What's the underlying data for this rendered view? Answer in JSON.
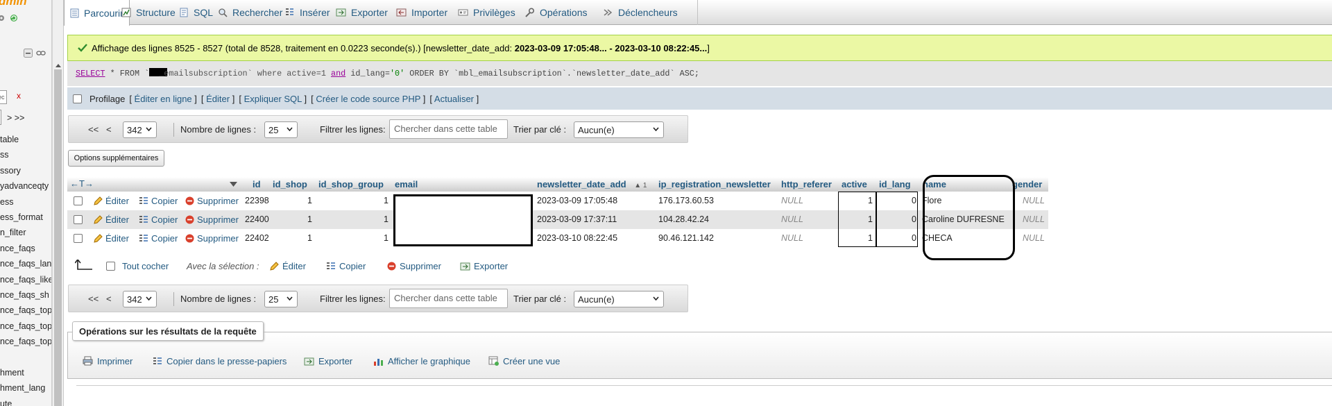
{
  "sidebar": {
    "logo_fragment": "dmin",
    "tables": [
      "table",
      "ss",
      "ssory",
      "yadvanceqty",
      "ess",
      "ess_format",
      "n_filter",
      "nce_faqs",
      "nce_faqs_lan",
      "nce_faqs_like",
      "nce_faqs_sh",
      "nce_faqs_top",
      "nce_faqs_top",
      "nce_faqs_top",
      "",
      "hment",
      "hment_lang",
      "ute"
    ],
    "filter_value": "ec",
    "filter_clear": "x",
    "pager": "> >>"
  },
  "tabs": [
    {
      "label": "Parcourir",
      "icon": "browse-icon",
      "active": true
    },
    {
      "label": "Structure",
      "icon": "structure-icon"
    },
    {
      "label": "SQL",
      "icon": "sql-icon"
    },
    {
      "label": "Rechercher",
      "icon": "search-icon"
    },
    {
      "label": "Insérer",
      "icon": "insert-icon"
    },
    {
      "label": "Exporter",
      "icon": "export-icon"
    },
    {
      "label": "Importer",
      "icon": "import-icon"
    },
    {
      "label": "Privilèges",
      "icon": "privileges-icon"
    },
    {
      "label": "Opérations",
      "icon": "operations-icon"
    },
    {
      "label": "Déclencheurs",
      "icon": "triggers-icon"
    }
  ],
  "message": {
    "text": "Affichage des lignes 8525 - 8527 (total de 8528, traitement en 0.0223 seconde(s).) [newsletter_date_add: ",
    "bold": "2023-03-09 17:05:48... - 2023-03-10 08:22:45...",
    "suffix": "]"
  },
  "query": {
    "select": "SELECT",
    "from_part": " * FROM `",
    "table": "_emailsubscription` where active=1 ",
    "and": "and",
    "cond": " id_lang=",
    "str": "'0'",
    "order": " ORDER BY `mbl_emailsubscription`.`newsletter_date_add` ASC;"
  },
  "profiling": {
    "label": "Profilage",
    "links": [
      "Éditer en ligne",
      "Éditer",
      "Expliquer SQL",
      "Créer le code source PHP",
      "Actualiser"
    ]
  },
  "nav": {
    "first": "<<",
    "prev": "<",
    "page": "342",
    "rows_label": "Nombre de lignes :",
    "rows_value": "25",
    "filter_label": "Filtrer les lignes:",
    "filter_placeholder": "Chercher dans cette table",
    "sort_label": "Trier par clé :",
    "sort_value": "Aucun(e)"
  },
  "options_button": "Options supplémentaires",
  "table": {
    "columns": [
      "id",
      "id_shop",
      "id_shop_group",
      "email",
      "newsletter_date_add",
      "ip_registration_newsletter",
      "http_referer",
      "active",
      "id_lang",
      "name",
      "gender"
    ],
    "sort_indicator": "▲ 1",
    "actions": {
      "edit": "Éditer",
      "copy": "Copier",
      "delete": "Supprimer"
    },
    "rows": [
      {
        "id": "22398",
        "id_shop": "1",
        "id_shop_group": "1",
        "email": "",
        "date": "2023-03-09 17:05:48",
        "ip": "176.173.60.53",
        "referer": "NULL",
        "active": "1",
        "id_lang": "0",
        "name": "Flore",
        "gender": "NULL"
      },
      {
        "id": "22400",
        "id_shop": "1",
        "id_shop_group": "1",
        "email": "",
        "date": "2023-03-09 17:37:11",
        "ip": "104.28.42.24",
        "referer": "NULL",
        "active": "1",
        "id_lang": "0",
        "name": "Caroline DUFRESNE",
        "gender": "NULL"
      },
      {
        "id": "22402",
        "id_shop": "1",
        "id_shop_group": "1",
        "email": "",
        "date": "2023-03-10 08:22:45",
        "ip": "90.46.121.142",
        "referer": "NULL",
        "active": "1",
        "id_lang": "0",
        "name": "CHECA",
        "gender": "NULL"
      }
    ]
  },
  "with_selection": {
    "check_all": "Tout cocher",
    "label": "Avec la sélection :",
    "edit": "Éditer",
    "copy": "Copier",
    "delete": "Supprimer",
    "export": "Exporter"
  },
  "query_results": {
    "legend": "Opérations sur les résultats de la requête",
    "buttons": [
      {
        "label": "Imprimer",
        "icon": "print-icon"
      },
      {
        "label": "Copier dans le presse-papiers",
        "icon": "copy-icon"
      },
      {
        "label": "Exporter",
        "icon": "export-icon"
      },
      {
        "label": "Afficher le graphique",
        "icon": "chart-icon"
      },
      {
        "label": "Créer une vue",
        "icon": "create-view-icon"
      }
    ]
  },
  "colors": {
    "link": "#235a81",
    "success_bg": "#ebf8a4",
    "profiling_bg": "#d4dde6"
  }
}
